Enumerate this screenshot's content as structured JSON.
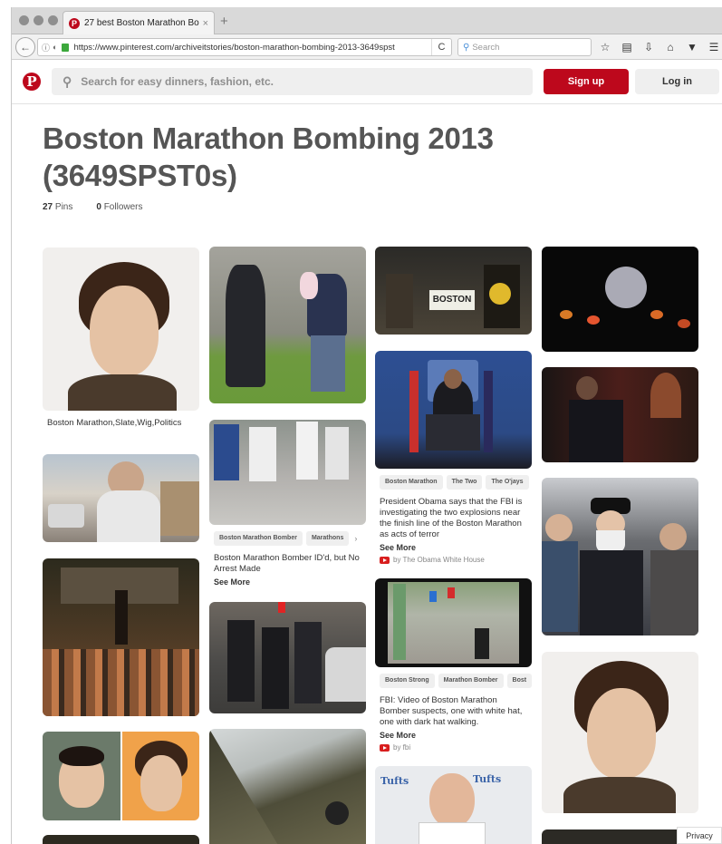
{
  "browser": {
    "tab_title": "27 best Boston Marathon Bom",
    "tab_close": "×",
    "new_tab": "+",
    "url": "https://www.pinterest.com/archiveitstories/boston-marathon-bombing-2013-3649spst",
    "search_placeholder": "Search",
    "reload": "C"
  },
  "header": {
    "logo": "P",
    "search_placeholder": "Search for easy dinners, fashion, etc.",
    "signup_label": "Sign up",
    "login_label": "Log in"
  },
  "board": {
    "title": "Boston Marathon Bombing 2013 (3649SPST0s)",
    "pins_count": "27",
    "pins_label": "Pins",
    "followers_count": "0",
    "followers_label": "Followers"
  },
  "pins": {
    "p1": {
      "caption": "Boston Marathon,Slate,Wig,Politics"
    },
    "p2": {
      "tags": [
        "Boston Marathon Bomber",
        "Marathons"
      ],
      "caption": "Boston Marathon Bomber ID'd, but No Arrest Made",
      "see_more": "See More"
    },
    "p3": {
      "tags": [
        "Boston Marathon",
        "The Two",
        "The O'jays"
      ],
      "caption": "President Obama says that the FBI is investigating the two explosions near the finish line of the Boston Marathon as acts of terror",
      "see_more": "See More",
      "source": "by The Obama White House",
      "sign_text": "BOSTON"
    },
    "p4": {
      "tags": [
        "Boston Strong",
        "Marathon Bomber",
        "Bost"
      ],
      "caption": "FBI: Video of Boston Marathon Bomber suspects, one with white hat, one with dark hat walking.",
      "see_more": "See More",
      "source": "by fbi"
    },
    "p5": {
      "sign_text": "Tufts"
    }
  },
  "footer": {
    "privacy": "Privacy"
  },
  "colors": {
    "brand": "#bd081c",
    "link": "#333333"
  },
  "icons": [
    "back-arrow-icon",
    "info-icon",
    "shield-icon",
    "lock-icon",
    "reload-icon",
    "search-icon",
    "star-icon",
    "reading-list-icon",
    "download-icon",
    "home-icon",
    "pocket-icon",
    "menu-icon",
    "pinterest-logo-icon",
    "youtube-icon"
  ]
}
